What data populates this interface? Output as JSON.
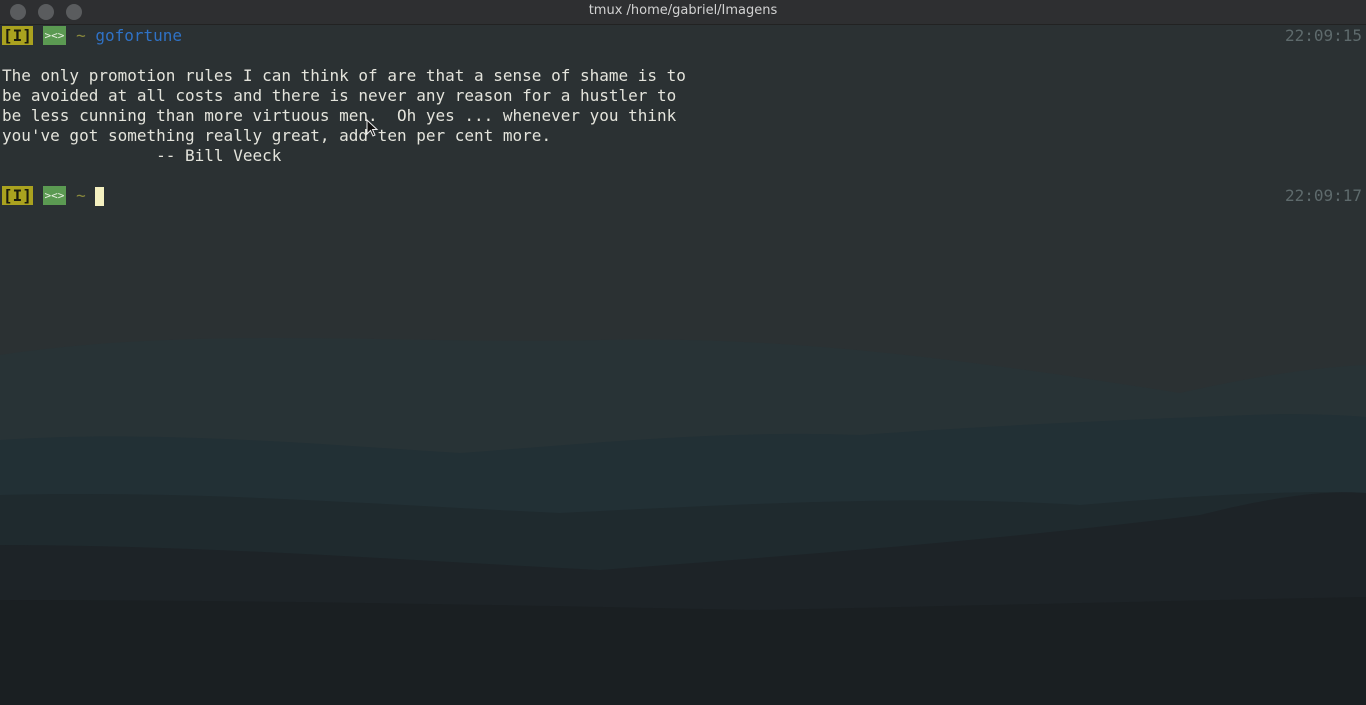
{
  "window": {
    "title": "tmux /home/gabriel/Imagens",
    "buttons": [
      "close",
      "minimize",
      "maximize"
    ]
  },
  "prompt": {
    "mode_badge": "[I]",
    "shell_badge": "><>",
    "cwd": "~"
  },
  "commands": [
    {
      "command": "gofortune",
      "timestamp": "22:09:15"
    }
  ],
  "output": {
    "lines": [
      "The only promotion rules I can think of are that a sense of shame is to",
      "be avoided at all costs and there is never any reason for a hustler to",
      "be less cunning than more virtuous men.  Oh yes ... whenever you think",
      "you've got something really great, add ten per cent more.",
      "                -- Bill Veeck"
    ]
  },
  "current_prompt": {
    "timestamp": "22:09:17"
  },
  "colors": {
    "background": "#2b3133",
    "text": "#e4e4dc",
    "command": "#2f72c6",
    "mode_badge_bg": "#aaa21f",
    "shell_badge_bg": "#5b9a52",
    "timestamp": "#5e6a6c",
    "cursor": "#f4f0c0"
  }
}
